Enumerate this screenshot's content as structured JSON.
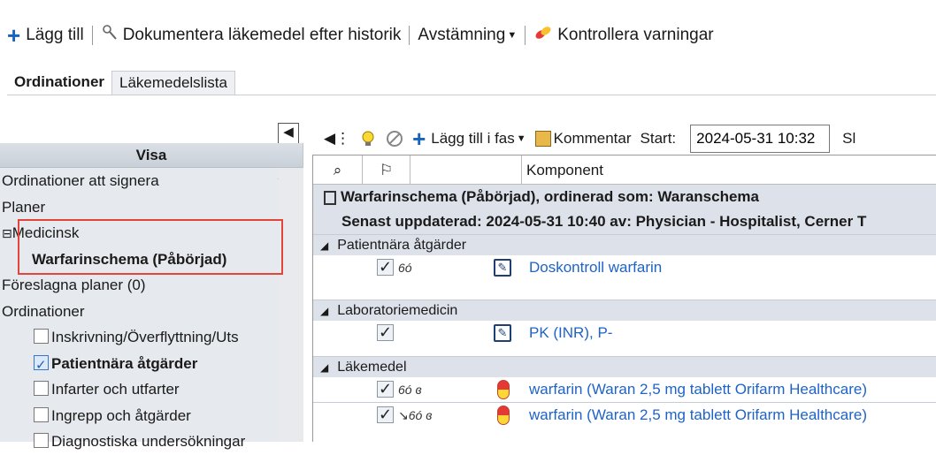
{
  "toolbar": {
    "add": "Lägg till",
    "document": "Dokumentera läkemedel efter historik",
    "reconcile": "Avstämning",
    "check_warnings": "Kontrollera varningar"
  },
  "tabs": {
    "orders": "Ordinationer",
    "med_list": "Läkemedelslista"
  },
  "left": {
    "header": "Visa",
    "items": [
      "Ordinationer att signera",
      "Planer",
      "Medicinsk",
      "Warfarinschema (Påbörjad)",
      "Föreslagna planer (0)",
      "Ordinationer",
      "Inskrivning/Överflyttning/Uts",
      "Patientnära åtgärder",
      "Infarter och utfarter",
      "Ingrepp och åtgärder",
      "Diagnostiska undersökningar"
    ]
  },
  "right_toolbar": {
    "add_phase": "Lägg till i fas",
    "comment": "Kommentar",
    "start_label": "Start:",
    "start_value": "2024-05-31 10:32",
    "trailing": "Sl"
  },
  "grid": {
    "col_component": "Komponent",
    "order_title": "Warfarinschema (Påbörjad), ordinerad som: Waranschema",
    "order_updated": "Senast uppdaterad: 2024-05-31 10:40   av: Physician - Hospitalist, Cerner T",
    "cat1": "Patientnära åtgärder",
    "item1": "Doskontroll warfarin",
    "cat2": "Laboratoriemedicin",
    "item2": "PK (INR), P-",
    "cat3": "Läkemedel",
    "item3": "warfarin (Waran 2,5 mg tablett Orifarm Healthcare)",
    "item4": "warfarin (Waran 2,5 mg tablett Orifarm Healthcare)"
  }
}
